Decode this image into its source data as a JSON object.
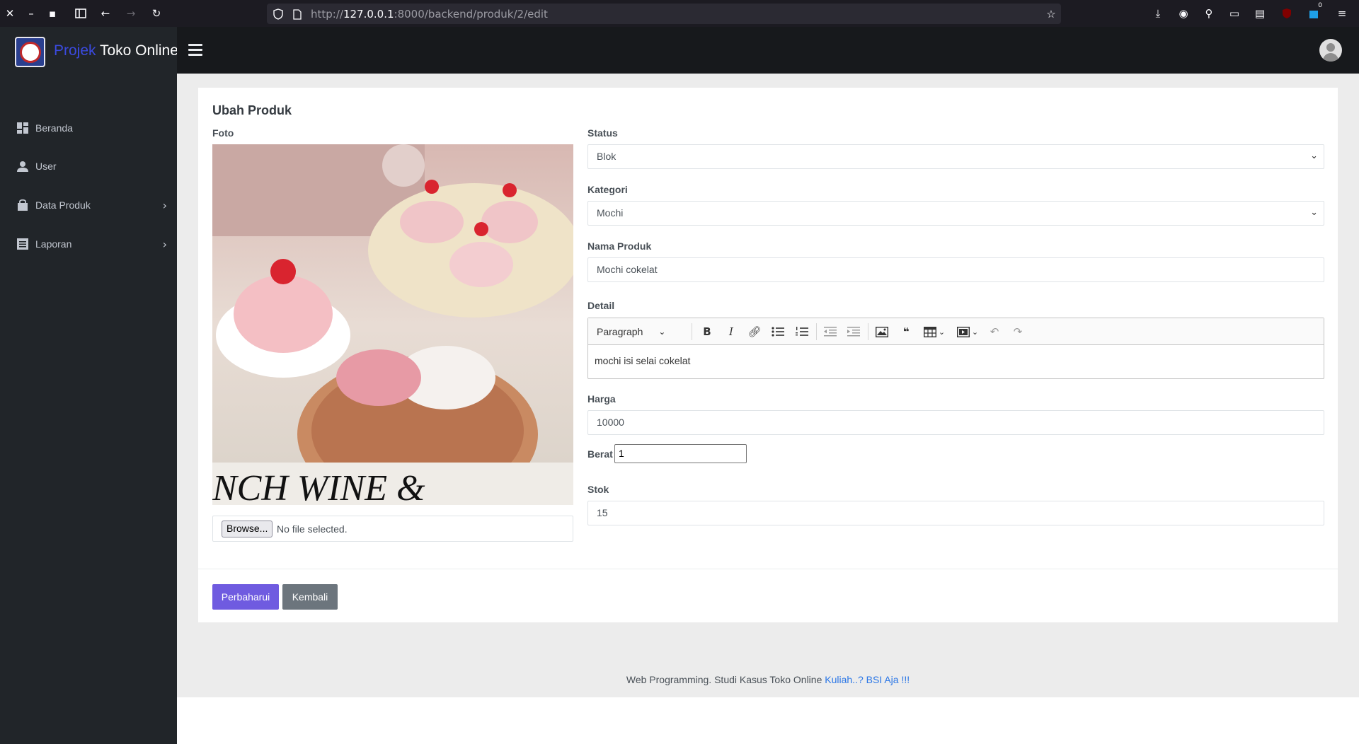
{
  "browser": {
    "url_prefix": "http://",
    "url_host": "127.0.0.1",
    "url_rest": ":8000/backend/produk/2/edit",
    "extension_badge": "0"
  },
  "brand": {
    "part1": "Projek",
    "part2": " Toko Online",
    "logo_text": "UNIVERSITAS"
  },
  "sidebar": {
    "items": [
      {
        "label": "Beranda",
        "icon": "dashboard-icon"
      },
      {
        "label": "User",
        "icon": "user-icon"
      },
      {
        "label": "Data Produk",
        "icon": "shopping-bag-icon"
      },
      {
        "label": "Laporan",
        "icon": "list-icon"
      }
    ]
  },
  "form": {
    "title": "Ubah Produk",
    "foto_label": "Foto",
    "photo_caption": "NCH WINE &",
    "browse_label": "Browse...",
    "file_status": "No file selected.",
    "status_label": "Status",
    "status_value": "Blok",
    "kategori_label": "Kategori",
    "kategori_value": "Mochi",
    "nama_label": "Nama Produk",
    "nama_value": "Mochi cokelat",
    "detail_label": "Detail",
    "editor_paragraph": "Paragraph",
    "detail_value": "mochi isi selai cokelat",
    "harga_label": "Harga",
    "harga_value": "10000",
    "berat_label": "Berat",
    "berat_value": "1",
    "stok_label": "Stok",
    "stok_value": "15",
    "submit_label": "Perbaharui",
    "back_label": "Kembali"
  },
  "footer": {
    "text": "Web Programming. Studi Kasus Toko Online ",
    "link": "Kuliah..? BSI Aja !!!"
  },
  "colors": {
    "sidebar_bg": "#212529",
    "topnav_bg": "#17191c",
    "primary": "#6f5be0",
    "secondary": "#6c757d",
    "link": "#2a76e6"
  }
}
